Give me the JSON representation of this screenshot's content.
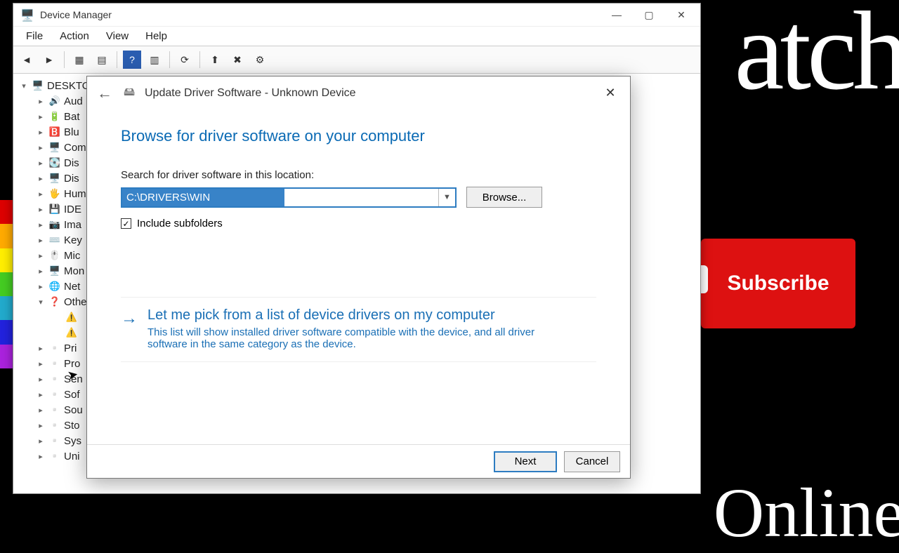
{
  "bg": {
    "top_word": "atch",
    "bottom_word": "Online",
    "subscribe": "Subscribe"
  },
  "window": {
    "title": "Device Manager",
    "menu": [
      "File",
      "Action",
      "View",
      "Help"
    ]
  },
  "tree": {
    "root": "DESKTOP",
    "items": [
      "Audio",
      "Batteries",
      "Bluetooth",
      "Computer",
      "Disk drives",
      "Display adapters",
      "Human Interface Devices",
      "IDE ATA/ATAPI controllers",
      "Imaging devices",
      "Keyboards",
      "Mice and other pointing devices",
      "Monitors",
      "Network adapters"
    ],
    "other_label": "Other devices",
    "items2": [
      "Print queues",
      "Processors",
      "Sensors",
      "Software devices",
      "Sound, video and game controllers",
      "Storage controllers",
      "System devices",
      "Universal Serial Bus controllers"
    ]
  },
  "dialog": {
    "title": "Update Driver Software - Unknown Device",
    "heading": "Browse for driver software on your computer",
    "search_label": "Search for driver software in this location:",
    "path": "C:\\DRIVERS\\WIN",
    "browse": "Browse...",
    "include_subfolders": "Include subfolders",
    "pick_title": "Let me pick from a list of device drivers on my computer",
    "pick_desc": "This list will show installed driver software compatible with the device, and all driver software in the same category as the device.",
    "next": "Next",
    "cancel": "Cancel"
  }
}
